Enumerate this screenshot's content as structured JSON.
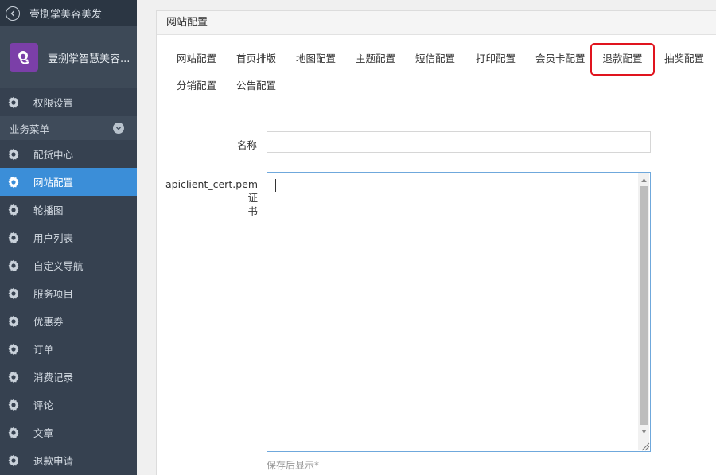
{
  "sidebar": {
    "top_title": "壹捌掌美容美发",
    "brand_name": "壹捌掌智慧美容...",
    "items_before_section": [
      {
        "label": "权限设置",
        "icon": "gear-icon"
      }
    ],
    "section_label": "业务菜单",
    "items": [
      {
        "label": "配货中心",
        "icon": "gear-icon",
        "active": false
      },
      {
        "label": "网站配置",
        "icon": "gear-icon",
        "active": true
      },
      {
        "label": "轮播图",
        "icon": "gear-icon",
        "active": false
      },
      {
        "label": "用户列表",
        "icon": "gear-icon",
        "active": false
      },
      {
        "label": "自定义导航",
        "icon": "gear-icon",
        "active": false
      },
      {
        "label": "服务项目",
        "icon": "gear-icon",
        "active": false
      },
      {
        "label": "优惠券",
        "icon": "gear-icon",
        "active": false
      },
      {
        "label": "订单",
        "icon": "gear-icon",
        "active": false
      },
      {
        "label": "消费记录",
        "icon": "gear-icon",
        "active": false
      },
      {
        "label": "评论",
        "icon": "gear-icon",
        "active": false
      },
      {
        "label": "文章",
        "icon": "gear-icon",
        "active": false
      },
      {
        "label": "退款申请",
        "icon": "gear-icon",
        "active": false
      }
    ]
  },
  "panel": {
    "title": "网站配置",
    "tabs": [
      {
        "label": "网站配置"
      },
      {
        "label": "首页排版"
      },
      {
        "label": "地图配置"
      },
      {
        "label": "主题配置"
      },
      {
        "label": "短信配置"
      },
      {
        "label": "打印配置"
      },
      {
        "label": "会员卡配置"
      },
      {
        "label": "退款配置",
        "highlighted": true
      },
      {
        "label": "抽奖配置"
      },
      {
        "label": "分销配置"
      },
      {
        "label": "公告配置"
      }
    ]
  },
  "form": {
    "name_label": "名称",
    "name_value": "",
    "cert_label_line1": "apiclient_cert.pem 证",
    "cert_label_line2": "书",
    "cert_value": "",
    "hint": "保存后显示*"
  },
  "colors": {
    "sidebar_bg": "#364150",
    "active_bg": "#3b8ed8",
    "highlight_border": "#e0141e",
    "brand_logo": "#7b3fa8"
  }
}
